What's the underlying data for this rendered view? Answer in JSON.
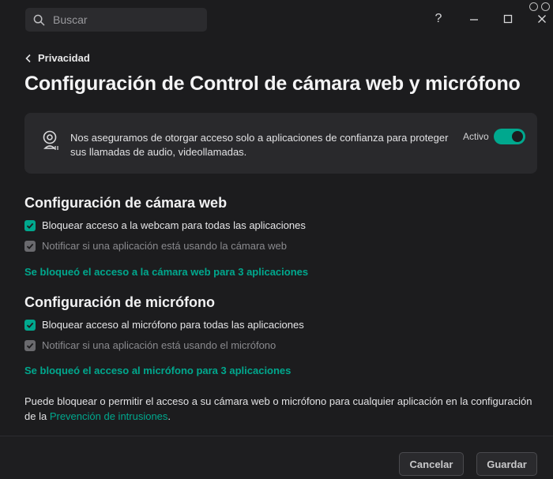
{
  "search": {
    "placeholder": "Buscar"
  },
  "window": {
    "help_label": "?"
  },
  "breadcrumb": {
    "label": "Privacidad"
  },
  "page": {
    "title": "Configuración de Control de cámara web y micrófono"
  },
  "card": {
    "description": "Nos aseguramos de otorgar acceso solo a aplicaciones de confianza para proteger sus llamadas de audio, videollamadas.",
    "status_label": "Activo",
    "toggle_on": true
  },
  "webcam": {
    "title": "Configuración de cámara web",
    "block_label": "Bloquear acceso a la webcam para todas las aplicaciones",
    "notify_label": "Notificar si una aplicación está usando la cámara web",
    "blocked_link": "Se bloqueó el acceso a la cámara web para 3 aplicaciones"
  },
  "microphone": {
    "title": "Configuración de micrófono",
    "block_label": "Bloquear acceso al micrófono para todas las aplicaciones",
    "notify_label": "Notificar si una aplicación está usando el micrófono",
    "blocked_link": "Se bloqueó el acceso al micrófono para 3 aplicaciones"
  },
  "footnote": {
    "text": "Puede bloquear o permitir el acceso a su cámara web o micrófono para cualquier aplicación en la configuración de la",
    "link": "Prevención de intrusiones",
    "suffix": "."
  },
  "footer": {
    "cancel_label": "Cancelar",
    "save_label": "Guardar"
  },
  "colors": {
    "accent": "#00a88e",
    "background": "#1c1c1e",
    "card": "#29292c"
  },
  "icons": [
    "search-icon",
    "help-icon",
    "minimize-icon",
    "maximize-icon",
    "close-icon",
    "chevron-left-icon",
    "webcam-icon",
    "checkmark-icon"
  ]
}
